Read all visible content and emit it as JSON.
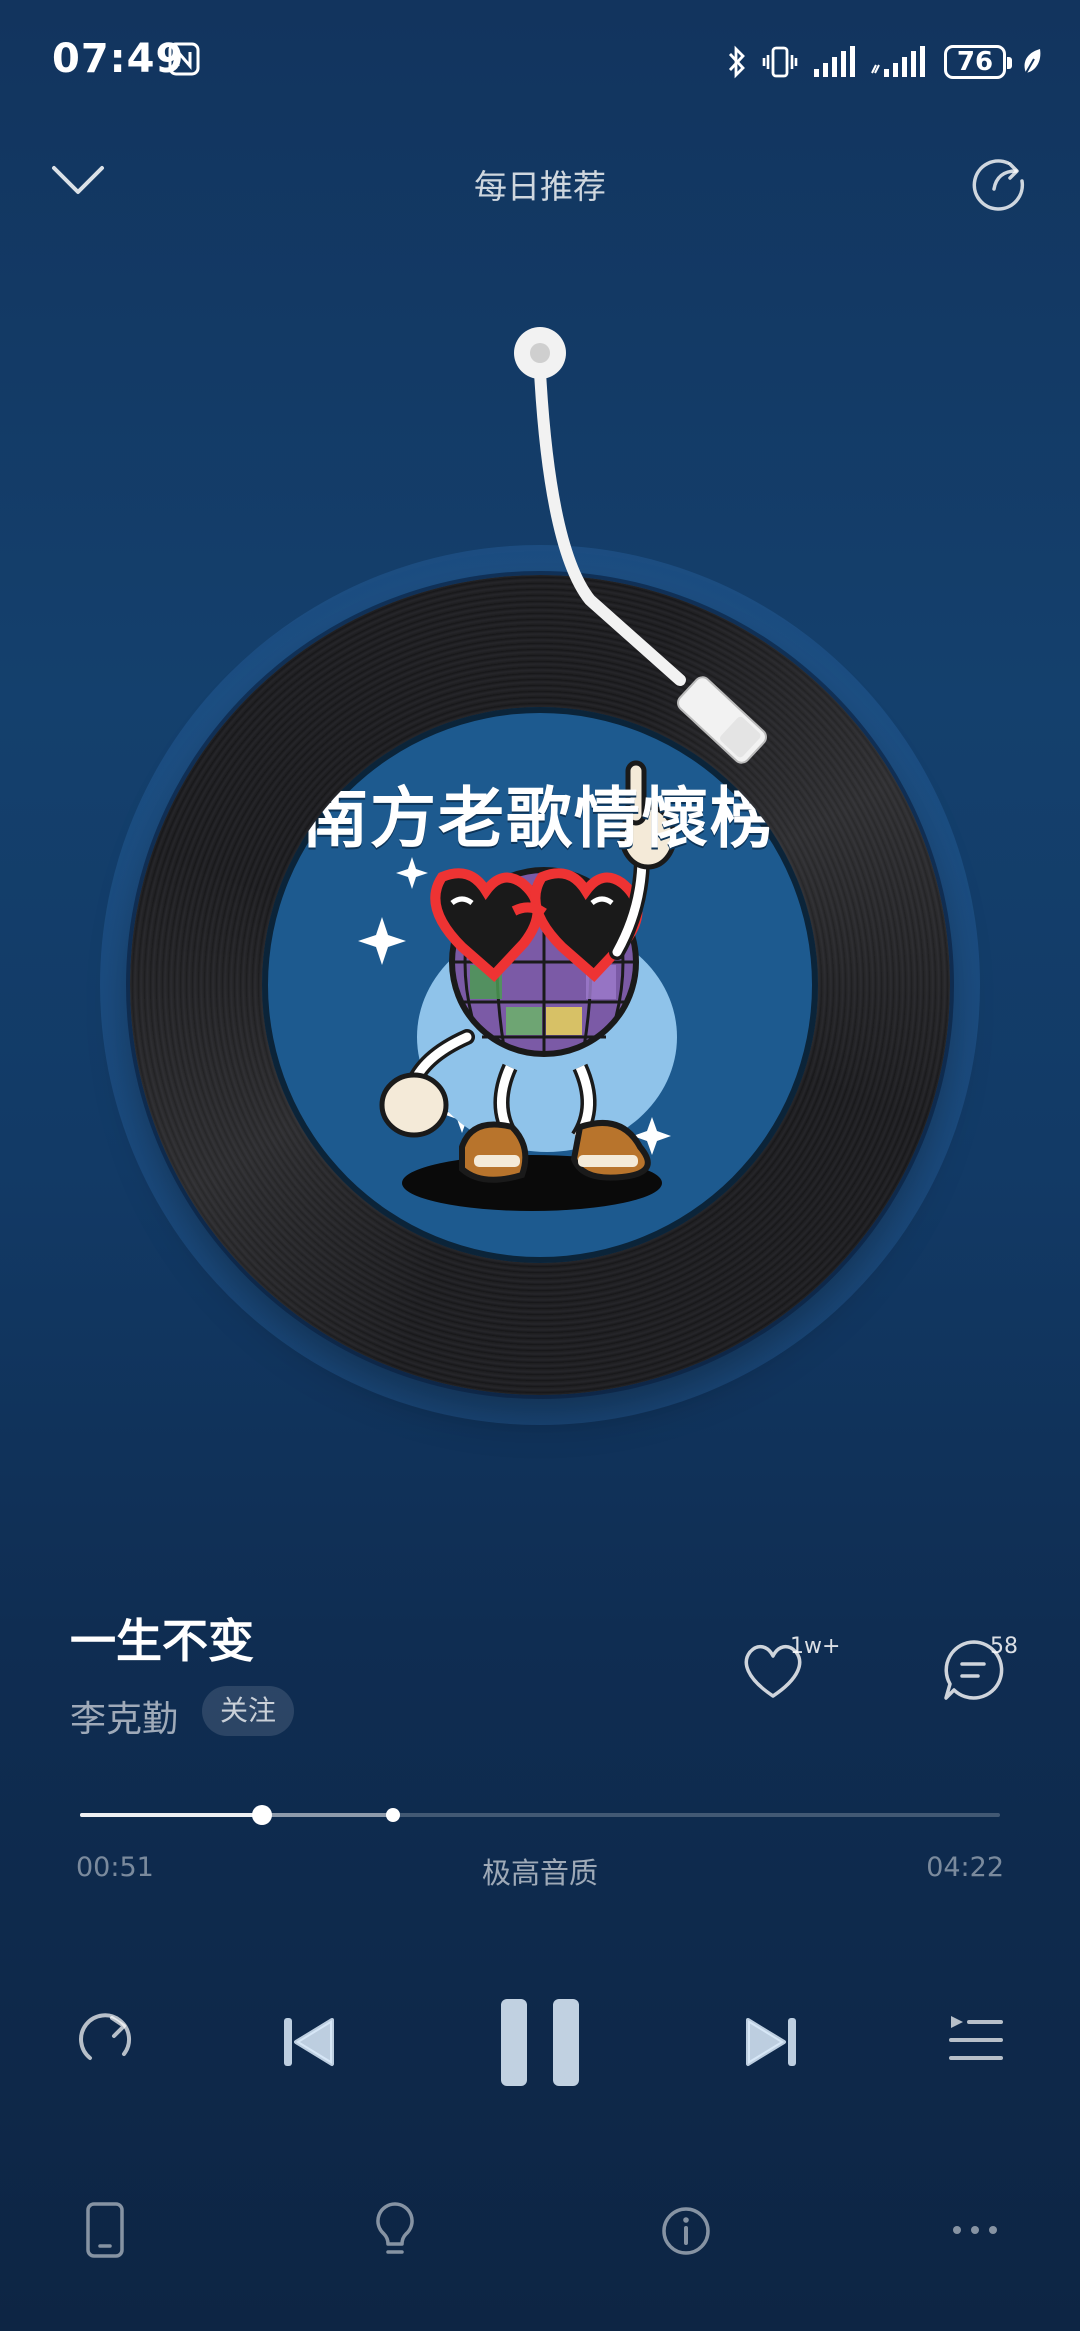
{
  "status_bar": {
    "time": "07:49",
    "battery": "76",
    "icons": [
      "nfc-icon",
      "bluetooth-icon",
      "vibrate-icon",
      "signal-icon",
      "signal-icon",
      "battery-icon",
      "leaf-icon"
    ]
  },
  "header": {
    "title": "每日推荐",
    "left_icon": "chevron-down-icon",
    "right_icon": "share-icon"
  },
  "album": {
    "cover_text": "南方老歌情懷榜"
  },
  "song": {
    "title": "一生不变",
    "artist": "李克勤",
    "follow_label": "关注",
    "like_count": "1w+",
    "comment_count": "58"
  },
  "progress": {
    "current": "00:51",
    "total": "04:22",
    "quality": "极高音质",
    "played_fraction": 0.198,
    "buffered_fraction": 0.34
  },
  "controls": {
    "icons": [
      "repeat-icon",
      "previous-icon",
      "pause-icon",
      "next-icon",
      "playlist-icon"
    ]
  },
  "toolbar": {
    "icons": [
      "phone-device-icon",
      "lightbulb-icon",
      "info-icon",
      "more-icon"
    ]
  },
  "colors": {
    "background_top": "#12345e",
    "background_bottom": "#0d2544",
    "accent": "#ffffff"
  }
}
